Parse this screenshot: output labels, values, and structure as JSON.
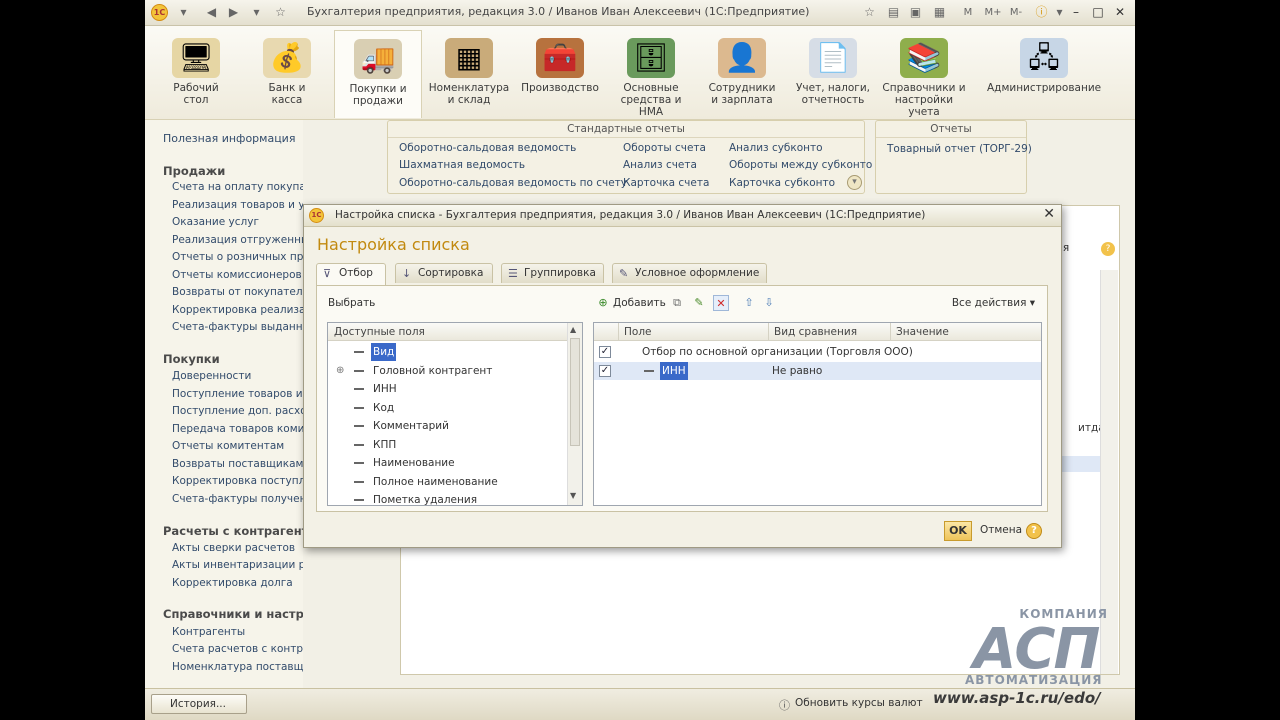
{
  "window": {
    "title": "Бухгалтерия предприятия, редакция 3.0 / Иванов Иван Алексеевич (1С:Предприятие)",
    "logo": "1С",
    "toolbar_right": [
      "M",
      "M+",
      "M-"
    ]
  },
  "sections": [
    {
      "label": "Рабочий\nстол",
      "icon": "desk-icon"
    },
    {
      "label": "Банк и\nкасса",
      "icon": "bank-icon"
    },
    {
      "label": "Покупки и\nпродажи",
      "icon": "truck-icon"
    },
    {
      "label": "Номенклатура\nи склад",
      "icon": "warehouse-icon"
    },
    {
      "label": "Производство",
      "icon": "toolbox-icon"
    },
    {
      "label": "Основные\nсредства и НМА",
      "icon": "cabinet-icon"
    },
    {
      "label": "Сотрудники\nи зарплата",
      "icon": "employee-icon"
    },
    {
      "label": "Учет, налоги,\nотчетность",
      "icon": "report-icon"
    },
    {
      "label": "Справочники и\nнастройки учета",
      "icon": "binders-icon"
    },
    {
      "label": "Администрирование",
      "icon": "admin-icon"
    }
  ],
  "nav": {
    "full_info": "Полезная информация",
    "groups": [
      {
        "title": "Продажи",
        "items": [
          "Счета на оплату покупателям",
          "Реализация товаров и усл",
          "Оказание услуг",
          "Реализация отгруженных",
          "Отчеты о розничных прод",
          "Отчеты комиссионеров о",
          "Возвраты от покупателей",
          "Корректировка реализаци",
          "Счета-фактуры выданные"
        ]
      },
      {
        "title": "Покупки",
        "items": [
          "Доверенности",
          "Поступление товаров и ус",
          "Поступление доп. расходо",
          "Передача товаров комите",
          "Отчеты комитентам",
          "Возвраты поставщикам",
          "Корректировка поступлен",
          "Счета-фактуры полученны"
        ]
      },
      {
        "title": "Расчеты с контрагента",
        "items": [
          "Акты сверки расчетов",
          "Акты инвентаризации расчетов",
          "Корректировка долга"
        ]
      },
      {
        "title": "Справочники и настройки",
        "items": [
          "Контрагенты",
          "Счета расчетов с контрагентами",
          "Номенклатура поставщика"
        ]
      }
    ]
  },
  "std_reports": {
    "title": "Стандартные отчеты",
    "col1": [
      "Оборотно-сальдовая ведомость",
      "Шахматная ведомость",
      "Оборотно-сальдовая ведомость по счету"
    ],
    "col2": [
      "Обороты счета",
      "Анализ счета",
      "Карточка счета"
    ],
    "col3": [
      "Анализ субконто",
      "Обороты между субконто",
      "Карточка субконто"
    ]
  },
  "reports": {
    "title": "Отчеты",
    "item": "Товарный отчет (ТОРГ-29)"
  },
  "background": {
    "more_label": "ия",
    "column_label": "итда"
  },
  "dialog": {
    "title": "Настройка списка - Бухгалтерия предприятия, редакция 3.0 / Иванов Иван Алексеевич (1С:Предприятие)",
    "heading": "Настройка списка",
    "tabs": [
      "Отбор",
      "Сортировка",
      "Группировка",
      "Условное оформление"
    ],
    "choose_label": "Выбрать",
    "toolbar": {
      "add": "Добавить",
      "all_actions": "Все действия"
    },
    "fields_header": "Доступные поля",
    "fields": [
      "Вид",
      "Головной контрагент",
      "ИНН",
      "Код",
      "Комментарий",
      "КПП",
      "Наименование",
      "Полное наименование",
      "Пометка удаления"
    ],
    "grid_columns": [
      "Поле",
      "Вид сравнения",
      "Значение"
    ],
    "grid_rows": [
      {
        "field": "Отбор по основной организации (Торговля ООО)",
        "comparison": "",
        "value": "",
        "checked": true
      },
      {
        "field": "ИНН",
        "comparison": "Не равно",
        "value": "",
        "checked": true
      }
    ],
    "ok": "OK",
    "cancel": "Отмена"
  },
  "status": {
    "history": "История...",
    "update_rates": "Обновить курсы валют"
  },
  "watermark": {
    "company": "КОМПАНИЯ",
    "logo": "АСП",
    "sub": "АВТОМАТИЗАЦИЯ",
    "url": "www.asp-1c.ru/edo/"
  }
}
